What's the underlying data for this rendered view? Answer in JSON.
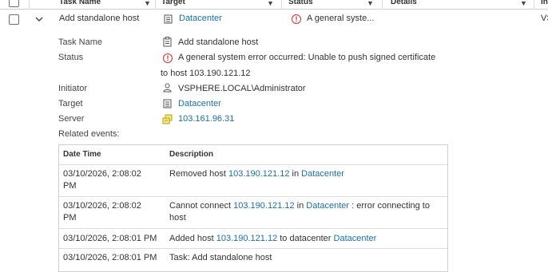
{
  "columns": {
    "task_name": "Task Name",
    "target": "Target",
    "status": "Status",
    "details": "Details",
    "initiator_partial": "Ini"
  },
  "row": {
    "task_name": "Add standalone host",
    "target": "Datacenter",
    "status": "A general syste...",
    "initiator_partial": "VS"
  },
  "details": {
    "task_name_label": "Task Name",
    "task_name_value": "Add standalone host",
    "status_label": "Status",
    "status_value_line1": "A general system error occurred: Unable to push signed certificate",
    "status_value_line2": "to host 103.190.121.12",
    "initiator_label": "Initiator",
    "initiator_value": "VSPHERE.LOCAL\\Administrator",
    "target_label": "Target",
    "target_value": "Datacenter",
    "server_label": "Server",
    "server_value": "103.161.96.31",
    "related_events_label": "Related events:"
  },
  "events": {
    "header_date": "Date Time",
    "header_desc": "Description",
    "rows": [
      {
        "date_line1": "03/10/2026, 2:08:02",
        "date_line2": "PM",
        "desc_a": "Removed host ",
        "desc_link1": "103.190.121.12",
        "desc_b": " in ",
        "desc_link2": "Datacenter",
        "desc_c": ""
      },
      {
        "date_line1": "03/10/2026, 2:08:02",
        "date_line2": "PM",
        "desc_a": "Cannot connect ",
        "desc_link1": "103.190.121.12",
        "desc_b": " in ",
        "desc_link2": "Datacenter",
        "desc_c": " : error connecting to",
        "desc_line2": "host"
      },
      {
        "date_line1": "03/10/2026, 2:08:01 PM",
        "desc_a": "Added host ",
        "desc_link1": "103.190.121.12",
        "desc_b": " to datacenter ",
        "desc_link2": "Datacenter"
      },
      {
        "date_line1": "03/10/2026, 2:08:01 PM",
        "desc_a": "Task: Add standalone host"
      }
    ]
  },
  "colors": {
    "link": "#1a6fa8",
    "error": "#d32f2f",
    "server_icon": "#c8b400"
  },
  "icons": [
    "filter-icon",
    "chevron-down-icon",
    "datacenter-icon",
    "error-icon",
    "task-icon",
    "user-icon",
    "server-icon"
  ]
}
